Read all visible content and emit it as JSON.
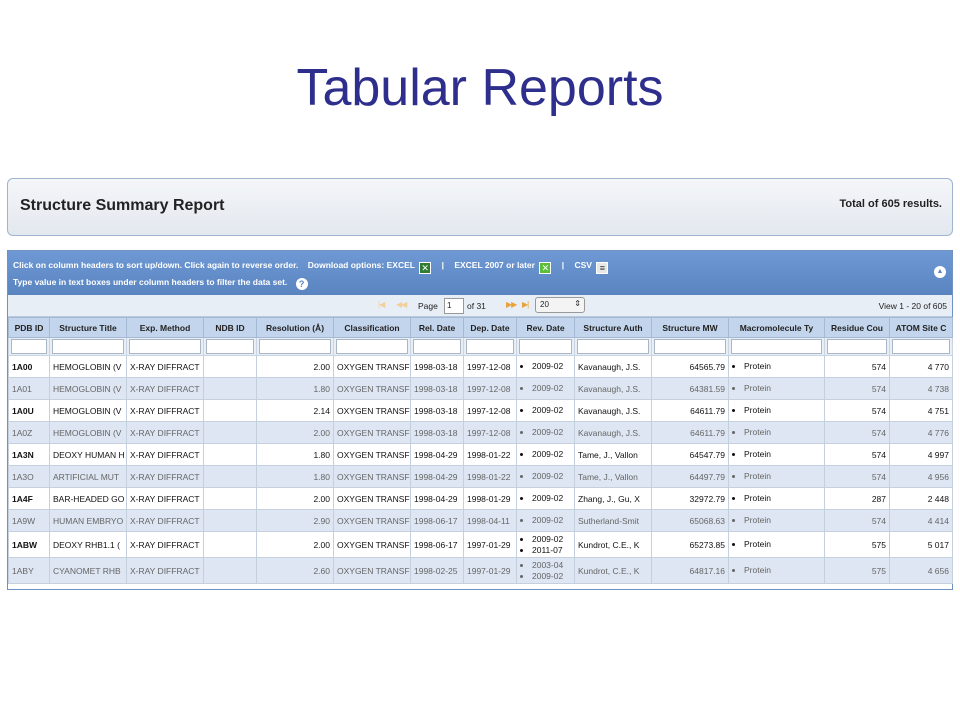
{
  "slide": {
    "title": "Tabular Reports"
  },
  "report": {
    "title": "Structure Summary Report",
    "total": "Total of 605 results."
  },
  "instructions": {
    "line1": "Click on column headers to sort up/down. Click again to reverse order.",
    "download_label": "Download options:",
    "excel": "EXCEL",
    "excel2007": "EXCEL 2007 or later",
    "csv": "CSV",
    "separator": "|",
    "line2": "Type value in text boxes under column headers to filter the data set."
  },
  "icons": {
    "excel": "excel-icon",
    "excel2007": "excel-2007-icon",
    "csv": "csv-icon",
    "help": "help-icon",
    "collapse": "collapse-up-icon",
    "first": "first-page-icon",
    "prev": "prev-page-icon",
    "next": "next-page-icon",
    "last": "last-page-icon"
  },
  "pager": {
    "first_glyph": "|◀",
    "prev_glyph": "◀◀",
    "next_glyph": "▶▶",
    "last_glyph": "▶|",
    "page_label": "Page",
    "page_value": "1",
    "of_label": "of 31",
    "page_size": "20",
    "page_size_arrow": "⇕",
    "view_text": "View 1 - 20 of 605"
  },
  "colors": {
    "header_blue": "#5a84c0",
    "row_alt": "#dde6f2",
    "title": "#2e2e8c"
  },
  "table": {
    "columns": [
      "PDB ID",
      "Structure Title",
      "Exp. Method",
      "NDB ID",
      "Resolution (Å)",
      "Classification",
      "Rel. Date",
      "Dep. Date",
      "Rev. Date",
      "Structure Auth",
      "Structure MW",
      "Macromolecule Ty",
      "Residue Cou",
      "ATOM Site C"
    ],
    "rows": [
      {
        "id": "1A00",
        "title": "HEMOGLOBIN (V",
        "method": "X-RAY DIFFRACT",
        "ndb": "",
        "res": "2.00",
        "cls": "OXYGEN TRANSF",
        "rel": "1998-03-18",
        "dep": "1997-12-08",
        "rev": [
          "2009-02"
        ],
        "auth": "Kavanaugh, J.S.",
        "mw": "64565.79",
        "type": [
          "Protein"
        ],
        "residue": "574",
        "atom": "4 770"
      },
      {
        "id": "1A01",
        "title": "HEMOGLOBIN (V",
        "method": "X-RAY DIFFRACT",
        "ndb": "",
        "res": "1.80",
        "cls": "OXYGEN TRANSF",
        "rel": "1998-03-18",
        "dep": "1997-12-08",
        "rev": [
          "2009-02"
        ],
        "auth": "Kavanaugh, J.S.",
        "mw": "64381.59",
        "type": [
          "Protein"
        ],
        "residue": "574",
        "atom": "4 738"
      },
      {
        "id": "1A0U",
        "title": "HEMOGLOBIN (V",
        "method": "X-RAY DIFFRACT",
        "ndb": "",
        "res": "2.14",
        "cls": "OXYGEN TRANSF",
        "rel": "1998-03-18",
        "dep": "1997-12-08",
        "rev": [
          "2009-02"
        ],
        "auth": "Kavanaugh, J.S.",
        "mw": "64611.79",
        "type": [
          "Protein"
        ],
        "residue": "574",
        "atom": "4 751"
      },
      {
        "id": "1A0Z",
        "title": "HEMOGLOBIN (V",
        "method": "X-RAY DIFFRACT",
        "ndb": "",
        "res": "2.00",
        "cls": "OXYGEN TRANSF",
        "rel": "1998-03-18",
        "dep": "1997-12-08",
        "rev": [
          "2009-02"
        ],
        "auth": "Kavanaugh, J.S.",
        "mw": "64611.79",
        "type": [
          "Protein"
        ],
        "residue": "574",
        "atom": "4 776"
      },
      {
        "id": "1A3N",
        "title": "DEOXY HUMAN H",
        "method": "X-RAY DIFFRACT",
        "ndb": "",
        "res": "1.80",
        "cls": "OXYGEN TRANSF",
        "rel": "1998-04-29",
        "dep": "1998-01-22",
        "rev": [
          "2009-02"
        ],
        "auth": "Tame, J., Vallon",
        "mw": "64547.79",
        "type": [
          "Protein"
        ],
        "residue": "574",
        "atom": "4 997"
      },
      {
        "id": "1A3O",
        "title": "ARTIFICIAL MUT",
        "method": "X-RAY DIFFRACT",
        "ndb": "",
        "res": "1.80",
        "cls": "OXYGEN TRANSF",
        "rel": "1998-04-29",
        "dep": "1998-01-22",
        "rev": [
          "2009-02"
        ],
        "auth": "Tame, J., Vallon",
        "mw": "64497.79",
        "type": [
          "Protein"
        ],
        "residue": "574",
        "atom": "4 956"
      },
      {
        "id": "1A4F",
        "title": "BAR-HEADED GO",
        "method": "X-RAY DIFFRACT",
        "ndb": "",
        "res": "2.00",
        "cls": "OXYGEN TRANSF",
        "rel": "1998-04-29",
        "dep": "1998-01-29",
        "rev": [
          "2009-02"
        ],
        "auth": "Zhang, J., Gu, X",
        "mw": "32972.79",
        "type": [
          "Protein"
        ],
        "residue": "287",
        "atom": "2 448"
      },
      {
        "id": "1A9W",
        "title": "HUMAN EMBRYO",
        "method": "X-RAY DIFFRACT",
        "ndb": "",
        "res": "2.90",
        "cls": "OXYGEN TRANSF",
        "rel": "1998-06-17",
        "dep": "1998-04-11",
        "rev": [
          "2009-02"
        ],
        "auth": "Sutherland-Smit",
        "mw": "65068.63",
        "type": [
          "Protein"
        ],
        "residue": "574",
        "atom": "4 414"
      },
      {
        "id": "1ABW",
        "title": "DEOXY RHB1.1 (",
        "method": "X-RAY DIFFRACT",
        "ndb": "",
        "res": "2.00",
        "cls": "OXYGEN TRANSF",
        "rel": "1998-06-17",
        "dep": "1997-01-29",
        "rev": [
          "2009-02",
          "2011-07"
        ],
        "auth": "Kundrot, C.E., K",
        "mw": "65273.85",
        "type": [
          "Protein"
        ],
        "residue": "575",
        "atom": "5 017"
      },
      {
        "id": "1ABY",
        "title": "CYANOMET RHB",
        "method": "X-RAY DIFFRACT",
        "ndb": "",
        "res": "2.60",
        "cls": "OXYGEN TRANSF",
        "rel": "1998-02-25",
        "dep": "1997-01-29",
        "rev": [
          "2003-04",
          "2009-02"
        ],
        "auth": "Kundrot, C.E., K",
        "mw": "64817.16",
        "type": [
          "Protein"
        ],
        "residue": "575",
        "atom": "4 656"
      }
    ]
  }
}
